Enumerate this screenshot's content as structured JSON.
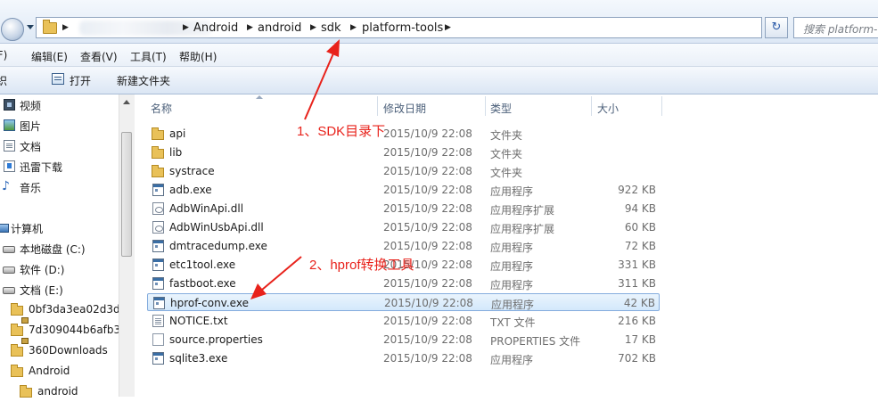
{
  "address_bar": {
    "crumbs": [
      "Android",
      "android",
      "sdk",
      "platform-tools"
    ],
    "search_placeholder": "搜索 platform-tools",
    "refresh_icon": "refresh-icon"
  },
  "menu": [
    "编辑(E)",
    "查看(V)",
    "工具(T)",
    "帮助(H)"
  ],
  "menu_partial": "(F)",
  "toolbar": {
    "organize_partial": "织",
    "open_label": "打开",
    "new_folder_label": "新建文件夹"
  },
  "nav": {
    "libraries": [
      {
        "label": "视频",
        "icon": "video-icon"
      },
      {
        "label": "图片",
        "icon": "pictures-icon"
      },
      {
        "label": "文档",
        "icon": "documents-icon"
      },
      {
        "label": "迅雷下载",
        "icon": "downloads-icon"
      },
      {
        "label": "音乐",
        "icon": "music-icon"
      }
    ],
    "computer": {
      "label": "计算机",
      "icon": "computer-icon"
    },
    "drives": [
      {
        "label": "本地磁盘 (C:)",
        "icon": "drive-icon"
      },
      {
        "label": "软件 (D:)",
        "icon": "drive-icon"
      },
      {
        "label": "文档 (E:)",
        "icon": "drive-icon"
      }
    ],
    "folders": [
      {
        "label": "0bf3da3ea02d3d",
        "icon": "locked-folder-icon"
      },
      {
        "label": "7d309044b6afb3(",
        "icon": "locked-folder-icon"
      },
      {
        "label": "360Downloads",
        "icon": "folder-icon"
      },
      {
        "label": "Android",
        "icon": "folder-icon"
      },
      {
        "label": "android",
        "icon": "folder-icon"
      }
    ]
  },
  "columns": {
    "name": "名称",
    "date": "修改日期",
    "type": "类型",
    "size": "大小"
  },
  "files": [
    {
      "name": "api",
      "date": "2015/10/9 22:08",
      "type": "文件夹",
      "size": "",
      "icon": "folder"
    },
    {
      "name": "lib",
      "date": "2015/10/9 22:08",
      "type": "文件夹",
      "size": "",
      "icon": "folder"
    },
    {
      "name": "systrace",
      "date": "2015/10/9 22:08",
      "type": "文件夹",
      "size": "",
      "icon": "folder"
    },
    {
      "name": "adb.exe",
      "date": "2015/10/9 22:08",
      "type": "应用程序",
      "size": "922 KB",
      "icon": "exe"
    },
    {
      "name": "AdbWinApi.dll",
      "date": "2015/10/9 22:08",
      "type": "应用程序扩展",
      "size": "94 KB",
      "icon": "dll"
    },
    {
      "name": "AdbWinUsbApi.dll",
      "date": "2015/10/9 22:08",
      "type": "应用程序扩展",
      "size": "60 KB",
      "icon": "dll"
    },
    {
      "name": "dmtracedump.exe",
      "date": "2015/10/9 22:08",
      "type": "应用程序",
      "size": "72 KB",
      "icon": "exe"
    },
    {
      "name": "etc1tool.exe",
      "date": "2015/10/9 22:08",
      "type": "应用程序",
      "size": "331 KB",
      "icon": "exe"
    },
    {
      "name": "fastboot.exe",
      "date": "2015/10/9 22:08",
      "type": "应用程序",
      "size": "311 KB",
      "icon": "exe"
    },
    {
      "name": "hprof-conv.exe",
      "date": "2015/10/9 22:08",
      "type": "应用程序",
      "size": "42 KB",
      "icon": "exe",
      "selected": true
    },
    {
      "name": "NOTICE.txt",
      "date": "2015/10/9 22:08",
      "type": "TXT 文件",
      "size": "216 KB",
      "icon": "txt"
    },
    {
      "name": "source.properties",
      "date": "2015/10/9 22:08",
      "type": "PROPERTIES 文件",
      "size": "17 KB",
      "icon": "blank"
    },
    {
      "name": "sqlite3.exe",
      "date": "2015/10/9 22:08",
      "type": "应用程序",
      "size": "702 KB",
      "icon": "exe"
    }
  ],
  "annotations": {
    "sdk_note": "1、SDK目录下",
    "hprof_note": "2、hprof转换工具",
    "color": "#e8221b"
  }
}
